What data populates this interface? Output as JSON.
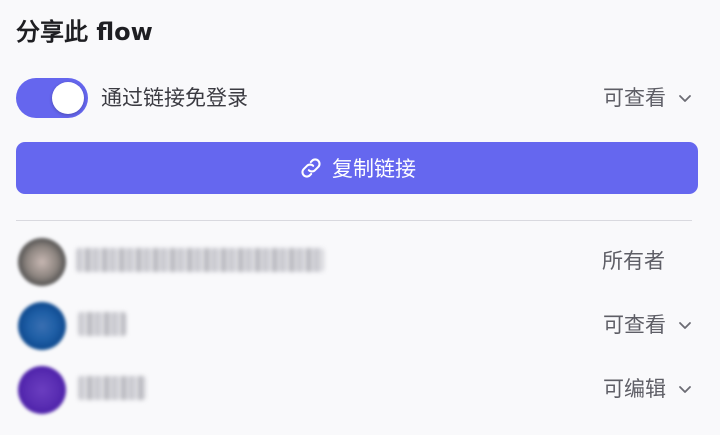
{
  "header": {
    "title": "分享此 flow"
  },
  "link_sharing": {
    "toggle_on": true,
    "label": "通过链接免登录",
    "permission": "可查看"
  },
  "copy_button": {
    "label": "复制链接"
  },
  "members": [
    {
      "role": "所有者",
      "has_dropdown": false
    },
    {
      "role": "可查看",
      "has_dropdown": true
    },
    {
      "role": "可编辑",
      "has_dropdown": true
    }
  ],
  "colors": {
    "accent": "#6567ef",
    "background": "#f9f9fb"
  }
}
